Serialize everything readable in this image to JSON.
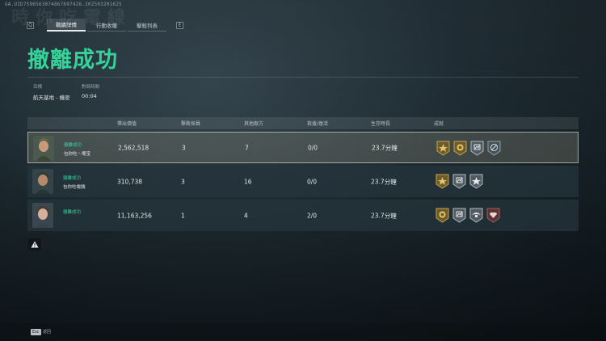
{
  "uid": "GA.UID7596563074867697426.202503201625",
  "watermark": "時 你 吃 電 線",
  "tabs": {
    "left_key": "Q",
    "right_key": "E",
    "items": [
      {
        "label": "戰績詳情",
        "active": true
      },
      {
        "label": "行動收穫",
        "active": false
      },
      {
        "label": "擊殺列表",
        "active": false
      }
    ]
  },
  "title": "撤離成功",
  "meta": {
    "target_label": "目標",
    "target_value": "航天基地 - 機密",
    "time_label": "對局時間",
    "time_value": "00:04"
  },
  "table": {
    "headers": {
      "value": "帶出價值",
      "kills": "擊敗探員",
      "other": "其他敵方",
      "rescue": "救援/復活",
      "survival": "生存時長",
      "achievements": "成就"
    },
    "rows": [
      {
        "status": "撤離成功",
        "name": "包你吃丶嘴宝",
        "value": "2,562,518",
        "kills": "3",
        "other": "7",
        "rescue": "0/0",
        "survival": "23.7分鐘",
        "highlight": true,
        "medals": [
          "gold-star-medal",
          "gold-sun-medal",
          "silver-chart-medal",
          "slate-target-medal"
        ]
      },
      {
        "status": "撤離成功",
        "name": "包你吃電銭",
        "value": "310,738",
        "kills": "3",
        "other": "16",
        "rescue": "0/0",
        "survival": "23.7分鐘",
        "highlight": false,
        "medals": [
          "gold-star-medal",
          "silver-chart-medal",
          "silver-star-medal"
        ]
      },
      {
        "status": "撤離成功",
        "name": "",
        "value": "11,163,256",
        "kills": "1",
        "other": "4",
        "rescue": "2/0",
        "survival": "23.7分鐘",
        "highlight": false,
        "medals": [
          "gold-sun-medal",
          "silver-chart-medal",
          "silver-wing-medal",
          "red-gem-medal"
        ]
      }
    ]
  },
  "footer": {
    "esc_key": "Esc",
    "back_label": "返回"
  },
  "colors": {
    "accent": "#35d29a",
    "gold": "#c7a24a",
    "silver": "#aeb7bd"
  }
}
